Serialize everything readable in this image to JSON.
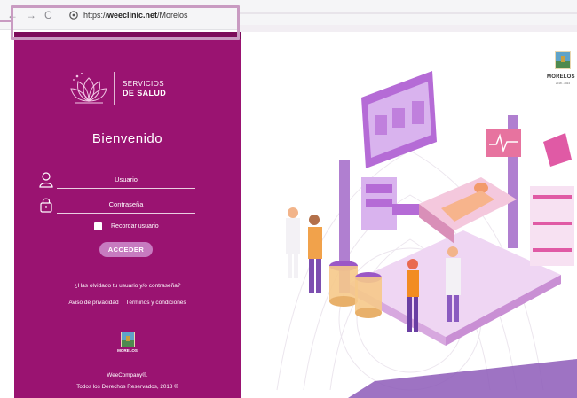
{
  "browser": {
    "back_icon": "arrow-left-icon",
    "forward_icon": "arrow-right-icon",
    "reload_icon": "reload-icon",
    "url_prefix": "https://",
    "url_host": "weeclinic.net",
    "url_path": "/Morelos"
  },
  "brand": {
    "line1": "SERVICIOS",
    "line2": "DE SALUD"
  },
  "login": {
    "welcome": "Bienvenido",
    "user_placeholder": "Usuario",
    "password_placeholder": "Contraseña",
    "remember_label": "Recordar usuario",
    "submit_label": "ACCEDER",
    "forgot_link": "¿Has olvidado tu usuario y/o contraseña?",
    "privacy_link": "Aviso de privacidad",
    "terms_link": "Términos y condiciones"
  },
  "footer": {
    "crest_label": "MORELOS",
    "company": "WeeCompany®.",
    "rights": "Todos los Derechos Reservados, 2018 ©"
  },
  "header_right": {
    "crest_label": "MORELOS",
    "crest_sub": "2018 - 2024"
  },
  "colors": {
    "panel": "#9a1371",
    "accent_button": "#c77bc0",
    "illustration_purple": "#b56bd6",
    "illustration_pink": "#e05aa5"
  }
}
